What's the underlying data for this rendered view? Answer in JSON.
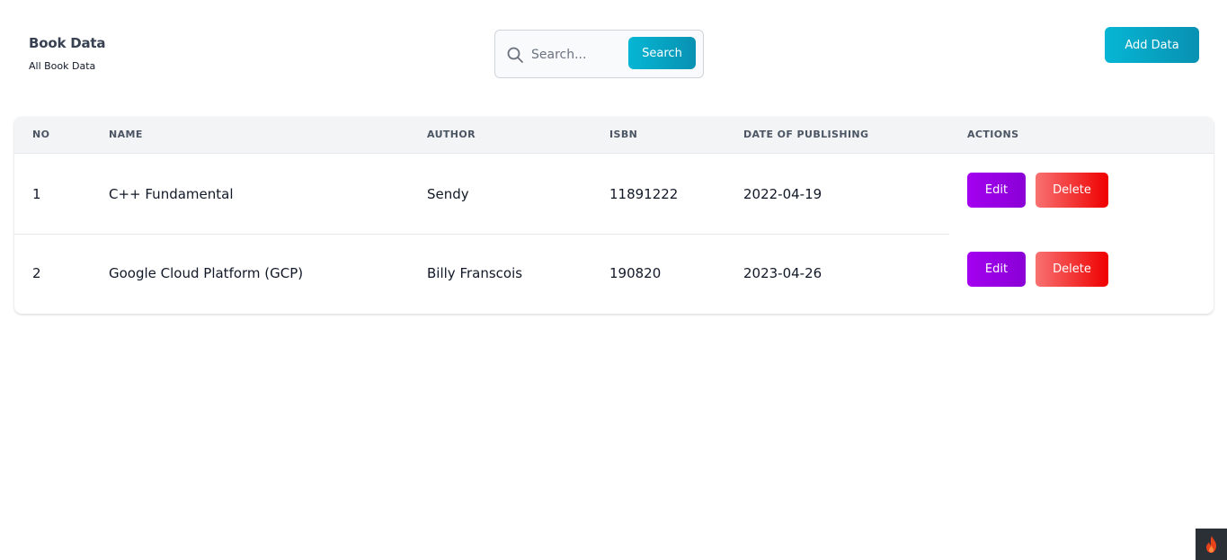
{
  "header": {
    "title": "Book Data",
    "subtitle": "All Book Data"
  },
  "search": {
    "placeholder": "Search...",
    "value": "",
    "button_label": "Search",
    "icon": "search-icon"
  },
  "actions": {
    "add_label": "Add Data"
  },
  "table": {
    "columns": [
      "NO",
      "NAME",
      "AUTHOR",
      "ISBN",
      "DATE OF PUBLISHING",
      "ACTIONS"
    ],
    "rows": [
      {
        "no": "1",
        "name": "C++ Fundamental",
        "author": "Sendy",
        "isbn": "11891222",
        "date": "2022-04-19",
        "edit_label": "Edit",
        "delete_label": "Delete"
      },
      {
        "no": "2",
        "name": "Google Cloud Platform (GCP)",
        "author": "Billy Franscois",
        "isbn": "190820",
        "date": "2023-04-26",
        "edit_label": "Edit",
        "delete_label": "Delete"
      }
    ]
  },
  "colors": {
    "accent": "#06b6d4",
    "edit": "#9d00f0",
    "delete": "#f00000"
  },
  "corner_badge": {
    "icon": "flame-icon"
  }
}
